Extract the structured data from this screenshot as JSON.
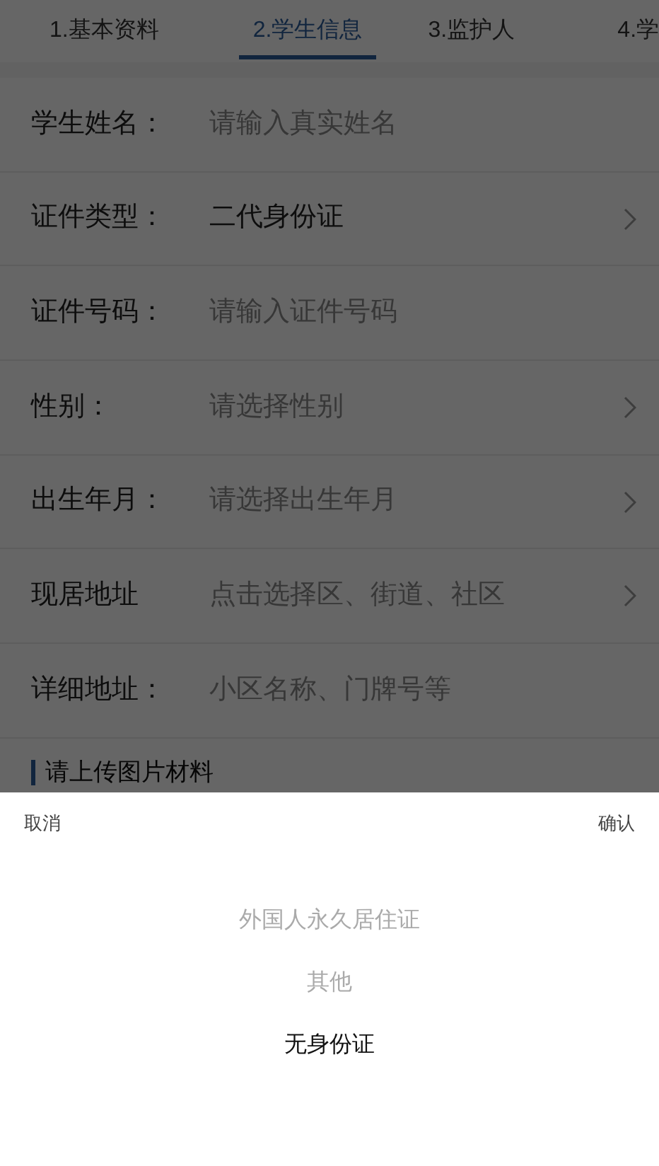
{
  "tabs": [
    {
      "label": "1.基本资料",
      "selected": false
    },
    {
      "label": "2.学生信息",
      "selected": true
    },
    {
      "label": "3.监护人",
      "selected": false
    },
    {
      "label": "4.学",
      "selected": false
    }
  ],
  "form": [
    {
      "label": "学生姓名：",
      "placeholder": "请输入真实姓名",
      "has_arrow": false
    },
    {
      "label": "证件类型：",
      "value": "二代身份证",
      "has_arrow": true
    },
    {
      "label": "证件号码：",
      "placeholder": "请输入证件号码",
      "has_arrow": false
    },
    {
      "label": "性别：",
      "placeholder": "请选择性别",
      "has_arrow": true
    },
    {
      "label": "出生年月：",
      "placeholder": "请选择出生年月",
      "has_arrow": true
    },
    {
      "label": "现居地址",
      "placeholder": "点击选择区、街道、社区",
      "has_arrow": true
    },
    {
      "label": "详细地址：",
      "placeholder": "小区名称、门牌号等",
      "has_arrow": false
    }
  ],
  "section_title": "请上传图片材料",
  "picker": {
    "cancel": "取消",
    "confirm": "确认",
    "options": [
      {
        "label": "外国人永久居住证",
        "selected": false
      },
      {
        "label": "其他",
        "selected": false
      },
      {
        "label": "无身份证",
        "selected": true
      }
    ]
  }
}
